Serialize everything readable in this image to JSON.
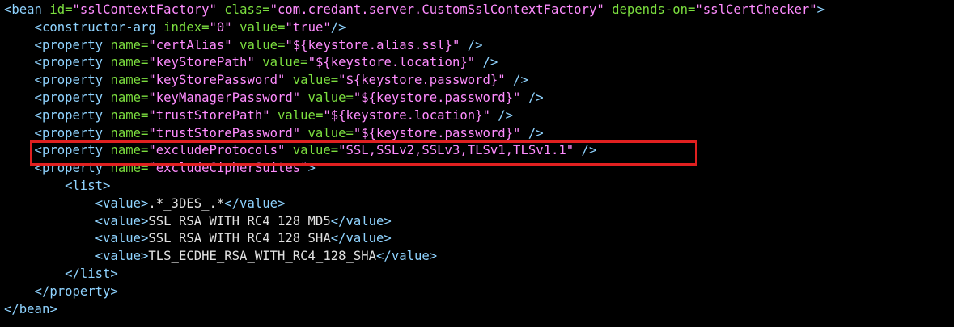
{
  "colors": {
    "background": "#000000",
    "tag": "#8fd3ff",
    "attribute": "#7cdf3f",
    "value": "#ff8cff",
    "text": "#e0e0e0",
    "highlight_border": "#e02020"
  },
  "lines": [
    [
      {
        "t": "tag",
        "v": "<bean "
      },
      {
        "t": "attr",
        "v": "id="
      },
      {
        "t": "val",
        "v": "\"sslContextFactory\""
      },
      {
        "t": "tag",
        "v": " "
      },
      {
        "t": "attr",
        "v": "class="
      },
      {
        "t": "val",
        "v": "\"com.credant.server.CustomSslContextFactory\""
      },
      {
        "t": "tag",
        "v": " "
      },
      {
        "t": "attr",
        "v": "depends-on="
      },
      {
        "t": "val",
        "v": "\"sslCertChecker\""
      },
      {
        "t": "tag",
        "v": ">"
      }
    ],
    [
      {
        "t": "tag",
        "v": "    <constructor-arg "
      },
      {
        "t": "attr",
        "v": "index="
      },
      {
        "t": "val",
        "v": "\"0\""
      },
      {
        "t": "tag",
        "v": " "
      },
      {
        "t": "attr",
        "v": "value="
      },
      {
        "t": "val",
        "v": "\"true\""
      },
      {
        "t": "tag",
        "v": "/>"
      }
    ],
    [
      {
        "t": "tag",
        "v": "    <property "
      },
      {
        "t": "attr",
        "v": "name="
      },
      {
        "t": "val",
        "v": "\"certAlias\""
      },
      {
        "t": "tag",
        "v": " "
      },
      {
        "t": "attr",
        "v": "value="
      },
      {
        "t": "val",
        "v": "\"${keystore.alias.ssl}\""
      },
      {
        "t": "tag",
        "v": " />"
      }
    ],
    [
      {
        "t": "tag",
        "v": "    <property "
      },
      {
        "t": "attr",
        "v": "name="
      },
      {
        "t": "val",
        "v": "\"keyStorePath\""
      },
      {
        "t": "tag",
        "v": " "
      },
      {
        "t": "attr",
        "v": "value="
      },
      {
        "t": "val",
        "v": "\"${keystore.location}\""
      },
      {
        "t": "tag",
        "v": " />"
      }
    ],
    [
      {
        "t": "tag",
        "v": "    <property "
      },
      {
        "t": "attr",
        "v": "name="
      },
      {
        "t": "val",
        "v": "\"keyStorePassword\""
      },
      {
        "t": "tag",
        "v": " "
      },
      {
        "t": "attr",
        "v": "value="
      },
      {
        "t": "val",
        "v": "\"${keystore.password}\""
      },
      {
        "t": "tag",
        "v": " />"
      }
    ],
    [
      {
        "t": "tag",
        "v": "    <property "
      },
      {
        "t": "attr",
        "v": "name="
      },
      {
        "t": "val",
        "v": "\"keyManagerPassword\""
      },
      {
        "t": "tag",
        "v": " "
      },
      {
        "t": "attr",
        "v": "value="
      },
      {
        "t": "val",
        "v": "\"${keystore.password}\""
      },
      {
        "t": "tag",
        "v": " />"
      }
    ],
    [
      {
        "t": "tag",
        "v": "    <property "
      },
      {
        "t": "attr",
        "v": "name="
      },
      {
        "t": "val",
        "v": "\"trustStorePath\""
      },
      {
        "t": "tag",
        "v": " "
      },
      {
        "t": "attr",
        "v": "value="
      },
      {
        "t": "val",
        "v": "\"${keystore.location}\""
      },
      {
        "t": "tag",
        "v": " />"
      }
    ],
    [
      {
        "t": "tag",
        "v": "    <property "
      },
      {
        "t": "attr",
        "v": "name="
      },
      {
        "t": "val",
        "v": "\"trustStorePassword\""
      },
      {
        "t": "tag",
        "v": " "
      },
      {
        "t": "attr",
        "v": "value="
      },
      {
        "t": "val",
        "v": "\"${keystore.password}\""
      },
      {
        "t": "tag",
        "v": " />"
      }
    ],
    [
      {
        "t": "tag",
        "v": "    <property "
      },
      {
        "t": "attr",
        "v": "name="
      },
      {
        "t": "val",
        "v": "\"excludeProtocols\""
      },
      {
        "t": "tag",
        "v": " "
      },
      {
        "t": "attr",
        "v": "value="
      },
      {
        "t": "val",
        "v": "\"SSL,SSLv2,SSLv3,TLSv1,TLSv1.1\""
      },
      {
        "t": "tag",
        "v": " />"
      }
    ],
    [
      {
        "t": "tag",
        "v": "    <property "
      },
      {
        "t": "attr",
        "v": "name="
      },
      {
        "t": "val",
        "v": "\"excludeCipherSuites\""
      },
      {
        "t": "tag",
        "v": ">"
      }
    ],
    [
      {
        "t": "tag",
        "v": "        <list>"
      }
    ],
    [
      {
        "t": "tag",
        "v": "            <value>"
      },
      {
        "t": "text",
        "v": ".*_3DES_.*"
      },
      {
        "t": "tag",
        "v": "</value>"
      }
    ],
    [
      {
        "t": "tag",
        "v": "            <value>"
      },
      {
        "t": "text",
        "v": "SSL_RSA_WITH_RC4_128_MD5"
      },
      {
        "t": "tag",
        "v": "</value>"
      }
    ],
    [
      {
        "t": "tag",
        "v": "            <value>"
      },
      {
        "t": "text",
        "v": "SSL_RSA_WITH_RC4_128_SHA"
      },
      {
        "t": "tag",
        "v": "</value>"
      }
    ],
    [
      {
        "t": "tag",
        "v": "            <value>"
      },
      {
        "t": "text",
        "v": "TLS_ECDHE_RSA_WITH_RC4_128_SHA"
      },
      {
        "t": "tag",
        "v": "</value>"
      }
    ],
    [
      {
        "t": "tag",
        "v": "        </list>"
      }
    ],
    [
      {
        "t": "tag",
        "v": "    </property>"
      }
    ],
    [
      {
        "t": "tag",
        "v": "</bean>"
      }
    ]
  ]
}
